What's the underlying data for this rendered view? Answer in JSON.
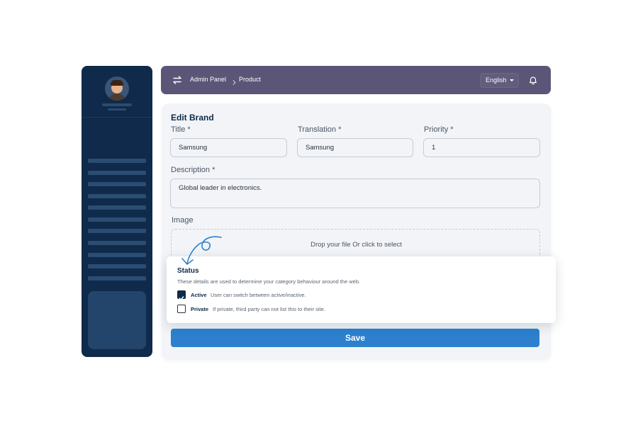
{
  "header": {
    "breadcrumb": [
      "Admin Panel",
      "Product"
    ],
    "language": "English"
  },
  "form": {
    "title": "Edit Brand",
    "fields": {
      "title": {
        "label": "Title *",
        "value": "Samsung"
      },
      "translation": {
        "label": "Translation *",
        "value": "Samsung"
      },
      "priority": {
        "label": "Priority *",
        "value": "1"
      },
      "description": {
        "label": "Description *",
        "value": "Global leader in electronics."
      }
    },
    "image": {
      "label": "Image",
      "dropzone_text": "Drop your file Or click to select"
    },
    "save_label": "Save"
  },
  "status": {
    "title": "Status",
    "description": "These details are used to determine your category behaviour around the web.",
    "options": [
      {
        "label": "Active",
        "hint": "User can switch between active/inactive.",
        "checked": true
      },
      {
        "label": "Private",
        "hint": "If private, third party can not list this to their site.",
        "checked": false
      }
    ]
  },
  "icons": {
    "swap": "swap-arrows-icon",
    "bell": "bell-icon",
    "chevron": "chevron-right-icon",
    "check": "check-icon"
  },
  "colors": {
    "sidebar": "#0f2a4a",
    "header": "#5b5577",
    "accent": "#2c80ce",
    "doodle": "#2c80ce"
  }
}
